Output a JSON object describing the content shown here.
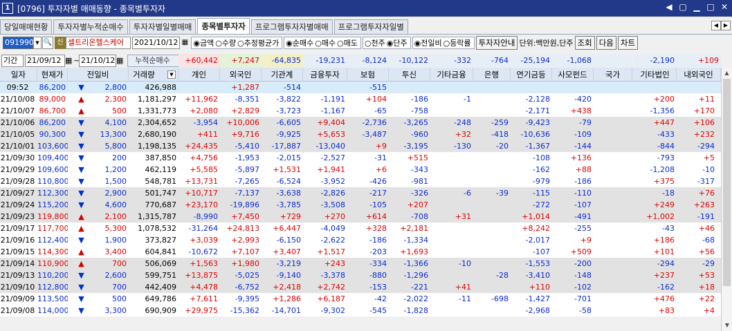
{
  "window": {
    "num": "1",
    "title": "[0796] 투자자별 매매동향 - 종목별투자자",
    "controls": [
      "◀",
      "▢",
      "▁",
      "□",
      "✕"
    ]
  },
  "tabs": [
    "당일매매현황",
    "투자자별누적순매수",
    "투자자별일별매매",
    "종목별투자자",
    "프로그램투자자별매매",
    "프로그램투자자일별"
  ],
  "active_tab": 3,
  "toolbar": {
    "code": "091990",
    "badge": "신",
    "name": "셀트리온헬스케어",
    "date": "2021/10/12",
    "radio_amount": [
      "◉금액",
      "○수량",
      "○추정평균가"
    ],
    "radio_buy": [
      "◉순매수",
      "○매수",
      "○매도"
    ],
    "radio_unit": [
      "○천주",
      "◉단주"
    ],
    "radio_cmp": [
      "◉전일비",
      "○등락률"
    ],
    "btn_info": "투자자안내",
    "unit": "단위:백만원,단주",
    "btn_query": "조회",
    "btn_next": "다음",
    "btn_chart": "차트"
  },
  "period": {
    "label": "기간",
    "from": "21/09/12",
    "to": "21/10/12",
    "cum_label": "누적순매수",
    "sums": [
      "+60,442",
      "+7,247",
      "-64,835",
      "-19,231",
      "-8,124",
      "-10,122",
      "-332",
      "-764",
      "-25,194",
      "-1,068",
      "",
      "-2,190",
      "+109"
    ]
  },
  "headers": [
    "일자",
    "현재가",
    "전일비",
    "거래량",
    "개인",
    "외국인",
    "기관계",
    "금융투자",
    "보험",
    "투신",
    "기타금융",
    "은행",
    "연기금등",
    "사모펀드",
    "국가",
    "기타법인",
    "내외국인"
  ],
  "rows": [
    [
      "09:52",
      "86,200",
      "▼",
      "2,800",
      "426,988",
      "",
      "+1,287",
      "-514",
      "",
      "-515",
      "",
      "",
      "",
      "",
      "",
      "",
      ""
    ],
    [
      "21/10/08",
      "89,000",
      "▲",
      "2,300",
      "1,181,297",
      "+11,962",
      "-8,351",
      "-3,822",
      "-1,191",
      "+104",
      "-186",
      "-1",
      "",
      "-2,128",
      "-420",
      "",
      "+200",
      "+11"
    ],
    [
      "21/10/07",
      "86,700",
      "▲",
      "500",
      "1,331,773",
      "+2,080",
      "+2,829",
      "-3,723",
      "-1,167",
      "-65",
      "-758",
      "",
      "",
      "-2,171",
      "+438",
      "",
      "-1,356",
      "+170"
    ],
    [
      "21/10/06",
      "86,200",
      "▼",
      "4,100",
      "2,304,652",
      "-3,954",
      "+10,006",
      "-6,605",
      "+9,404",
      "-2,736",
      "-3,265",
      "-248",
      "-259",
      "-9,423",
      "-79",
      "",
      "+447",
      "+106"
    ],
    [
      "21/10/05",
      "90,300",
      "▼",
      "13,300",
      "2,680,190",
      "+411",
      "+9,716",
      "-9,925",
      "+5,653",
      "-3,487",
      "-960",
      "+32",
      "-418",
      "-10,636",
      "-109",
      "",
      "-433",
      "+232"
    ],
    [
      "21/10/01",
      "103,600",
      "▼",
      "5,800",
      "1,198,135",
      "+24,435",
      "-5,410",
      "-17,887",
      "-13,040",
      "+9",
      "-3,195",
      "-130",
      "-20",
      "-1,367",
      "-144",
      "",
      "-844",
      "-294"
    ],
    [
      "21/09/30",
      "109,400",
      "▼",
      "200",
      "387,850",
      "+4,756",
      "-1,953",
      "-2,015",
      "-2,527",
      "-31",
      "+515",
      "",
      "",
      "-108",
      "+136",
      "",
      "-793",
      "+5"
    ],
    [
      "21/09/29",
      "109,600",
      "▼",
      "1,200",
      "462,119",
      "+5,585",
      "-5,897",
      "+1,531",
      "+1,941",
      "+6",
      "-343",
      "",
      "",
      "-162",
      "+88",
      "",
      "-1,208",
      "-10"
    ],
    [
      "21/09/28",
      "110,800",
      "▼",
      "1,500",
      "548,781",
      "+13,731",
      "-7,265",
      "-6,524",
      "-3,952",
      "-426",
      "-981",
      "",
      "",
      "-979",
      "-186",
      "",
      "+375",
      "-317"
    ],
    [
      "21/09/27",
      "112,300",
      "▼",
      "2,900",
      "501,747",
      "+10,717",
      "-7,137",
      "-3,638",
      "-2,826",
      "-217",
      "-326",
      "-6",
      "-39",
      "-115",
      "-110",
      "",
      "-18",
      "+76"
    ],
    [
      "21/09/24",
      "115,200",
      "▼",
      "4,600",
      "770,687",
      "+23,170",
      "-19,896",
      "-3,785",
      "-3,508",
      "-105",
      "+207",
      "",
      "",
      "-272",
      "-107",
      "",
      "+249",
      "+263"
    ],
    [
      "21/09/23",
      "119,800",
      "▲",
      "2,100",
      "1,315,787",
      "-8,990",
      "+7,450",
      "+729",
      "+270",
      "+614",
      "-708",
      "+31",
      "",
      "+1,014",
      "-491",
      "",
      "+1,002",
      "-191"
    ],
    [
      "21/09/17",
      "117,700",
      "▲",
      "5,300",
      "1,078,532",
      "-31,264",
      "+24,813",
      "+6,447",
      "-4,049",
      "+328",
      "+2,181",
      "",
      "",
      "+8,242",
      "-255",
      "",
      "-43",
      "+46"
    ],
    [
      "21/09/16",
      "112,400",
      "▼",
      "1,900",
      "373,827",
      "+3,039",
      "+2,993",
      "-6,150",
      "-2,622",
      "-186",
      "-1,334",
      "",
      "",
      "-2,017",
      "+9",
      "",
      "+186",
      "-68"
    ],
    [
      "21/09/15",
      "114,300",
      "▲",
      "3,400",
      "604,841",
      "-10,672",
      "+7,107",
      "+3,407",
      "+1,517",
      "-203",
      "+1,693",
      "",
      "",
      "-107",
      "+509",
      "",
      "+101",
      "+56"
    ],
    [
      "21/09/14",
      "110,900",
      "▲",
      "700",
      "506,069",
      "+1,563",
      "+1,980",
      "-3,219",
      "+243",
      "-334",
      "-1,366",
      "-10",
      "",
      "-1,553",
      "-200",
      "",
      "-294",
      "-29"
    ],
    [
      "21/09/13",
      "110,200",
      "▼",
      "2,600",
      "599,751",
      "+13,875",
      "-5,025",
      "-9,140",
      "-3,378",
      "-880",
      "-1,296",
      "",
      "-28",
      "-3,410",
      "-148",
      "",
      "+237",
      "+53"
    ],
    [
      "21/09/10",
      "112,800",
      "▼",
      "700",
      "442,409",
      "+4,478",
      "-6,752",
      "+2,418",
      "+2,742",
      "-153",
      "-221",
      "+41",
      "",
      "+110",
      "-102",
      "",
      "-162",
      "+18"
    ],
    [
      "21/09/09",
      "113,500",
      "▼",
      "500",
      "649,786",
      "+7,611",
      "-9,395",
      "+1,286",
      "+6,187",
      "-42",
      "-2,022",
      "-11",
      "-698",
      "-1,427",
      "-701",
      "",
      "+476",
      "+22"
    ],
    [
      "21/09/08",
      "114,000",
      "▼",
      "3,300",
      "690,909",
      "+29,975",
      "-15,362",
      "-14,701",
      "-9,302",
      "-545",
      "-1,828",
      "",
      "",
      "-2,968",
      "-58",
      "",
      "+83",
      "+4"
    ]
  ],
  "colors": {
    "title_bg": "#22398a",
    "up": "#d00000",
    "down": "#0030c8"
  }
}
